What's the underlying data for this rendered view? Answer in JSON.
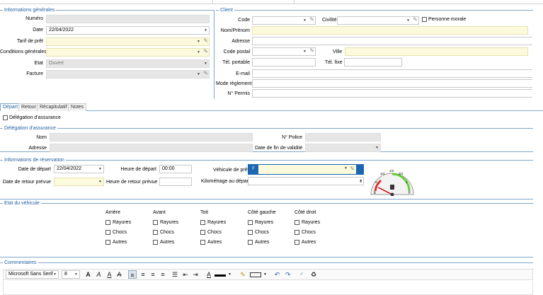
{
  "general": {
    "title": "Informations générales",
    "numero": {
      "label": "Numéro",
      "value": ""
    },
    "date": {
      "label": "Date",
      "value": "22/04/2022"
    },
    "tarif": {
      "label": "Tarif de prêt",
      "value": ""
    },
    "conditions": {
      "label": "Conditions générales",
      "value": ""
    },
    "etat": {
      "label": "Etat",
      "value": "Ouvert"
    },
    "facture": {
      "label": "Facture",
      "value": ""
    }
  },
  "client": {
    "title": "Client",
    "code": "Code",
    "civilite": "Civilité",
    "personne_morale": "Personne morale",
    "nom": "Nom/Prénom",
    "adresse": "Adresse",
    "cp": "Code postal",
    "ville": "Ville",
    "tel_portable": "Tél. portable",
    "tel_fixe": "Tél. fixe",
    "email": "E-mail",
    "mode_reglement": "Mode règlement",
    "permis": "N° Permis"
  },
  "tabs": [
    "Départ",
    "Retour",
    "Récapitulatif",
    "Notes"
  ],
  "delegation_check": "Délégation d'assurance",
  "delegation": {
    "title": "Délégation d'assurance",
    "nom": "Nom",
    "police": "N° Police",
    "adresse": "Adresse",
    "date_fin": "Date de fin de validité"
  },
  "reservation": {
    "title": "Informations de réservation",
    "date_depart": "Date de départ",
    "date_depart_value": "22/04/2022",
    "heure_depart": "Heure de départ",
    "heure_depart_value": "00:00",
    "vehicule": "Véhicule de prêt",
    "date_retour": "Date de retour prévue",
    "heure_retour": "Heure de retour prévue",
    "km_depart": "Kilométrage au départ"
  },
  "gauge": {
    "ticks": [
      "0",
      "1/4",
      "1/2",
      "3/4",
      "1"
    ],
    "start_letter": "E",
    "end_letter": "F",
    "level": 0.15
  },
  "etat_vehicule": {
    "title": "Etat du véhicule",
    "columns": [
      {
        "name": "Arrière",
        "opts": [
          "Rayures",
          "Chocs",
          "Autres"
        ]
      },
      {
        "name": "Avant",
        "opts": [
          "Rayures",
          "Chocs",
          "Autres"
        ]
      },
      {
        "name": "Toit",
        "opts": [
          "Rayures",
          "Chocs",
          "Autres"
        ]
      },
      {
        "name": "Côté gauche",
        "opts": [
          "Rayures",
          "Chocs",
          "Autres"
        ]
      },
      {
        "name": "Côté droit",
        "opts": [
          "Rayures",
          "Chocs",
          "Autres"
        ]
      }
    ]
  },
  "commentaires": {
    "title": "Commentaires",
    "font": "Microsoft Sans Serif",
    "size": "8"
  },
  "colors": {
    "accent": "#1f5f9f",
    "field_gray": "#e6e6e6",
    "field_yellow": "#fcfadc",
    "vehicle_icon": "#1a66b3"
  }
}
